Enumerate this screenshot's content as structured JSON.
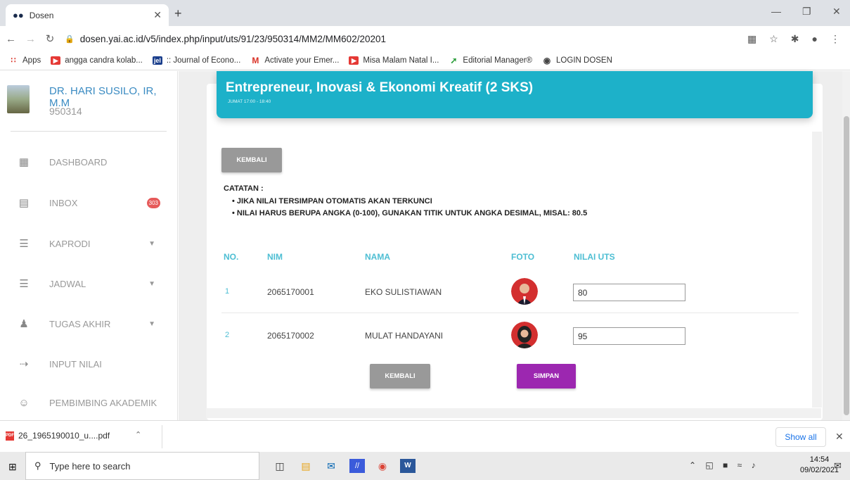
{
  "browser": {
    "tab_title": "Dosen",
    "url": "dosen.yai.ac.id/v5/index.php/input/uts/91/23/950314/MM2/MM602/20201",
    "bookmarks": [
      "Apps",
      "angga candra kolab...",
      ":: Journal of Econo...",
      "Activate your Emer...",
      "Misa Malam Natal I...",
      "Editorial Manager®",
      "LOGIN DOSEN"
    ]
  },
  "sidebar": {
    "user_name": "DR. HARI SUSILO, IR, M.M",
    "user_id": "950314",
    "items": [
      {
        "label": "DASHBOARD"
      },
      {
        "label": "INBOX",
        "badge": "303"
      },
      {
        "label": "KAPRODI"
      },
      {
        "label": "JADWAL"
      },
      {
        "label": "TUGAS AKHIR"
      },
      {
        "label": "INPUT NILAI"
      },
      {
        "label": "PEMBIMBING AKADEMIK"
      }
    ]
  },
  "course": {
    "title": "Entrepreneur, Inovasi & Ekonomi Kreatif (2 SKS)",
    "schedule": "JUMAT 17:00 - 18:40"
  },
  "buttons": {
    "back_top": "KEMBALI",
    "back_bottom": "KEMBALI",
    "save": "SIMPAN"
  },
  "notes": {
    "heading": "CATATAN :",
    "items": [
      "JIKA NILAI TERSIMPAN OTOMATIS AKAN TERKUNCI",
      "NILAI HARUS BERUPA ANGKA (0-100), GUNAKAN TITIK UNTUK ANGKA DESIMAL, MISAL: 80.5"
    ]
  },
  "table": {
    "headers": [
      "NO.",
      "NIM",
      "NAMA",
      "FOTO",
      "NILAI UTS"
    ],
    "rows": [
      {
        "no": "1",
        "nim": "2065170001",
        "nama": "EKO SULISTIAWAN",
        "nilai": "80"
      },
      {
        "no": "2",
        "nim": "2065170002",
        "nama": "MULAT HANDAYANI",
        "nilai": "95"
      }
    ]
  },
  "download": {
    "file": "26_1965190010_u....pdf",
    "show_all": "Show all"
  },
  "taskbar": {
    "search_placeholder": "Type here to search",
    "time": "14:54",
    "date": "09/02/2021"
  },
  "colors": {
    "accent": "#1db1c9",
    "header_text": "#4dbed3",
    "save": "#9c27b0",
    "back": "#999999",
    "badge": "#e65a5a"
  }
}
